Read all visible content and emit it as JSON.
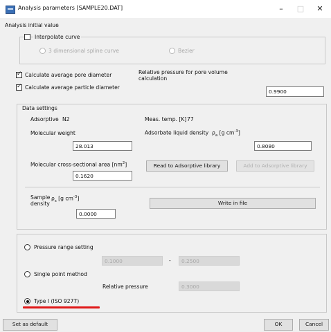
{
  "window": {
    "title": "Analysis parameters [SAMPLE20.DAT]",
    "min": "–",
    "max": "□",
    "close": "✕"
  },
  "analysis_initial_value": {
    "label": "Analysis initial value",
    "interpolate_label": "Interpolate curve",
    "spline_label": "3 dimensional spline curve",
    "bezier_label": "Bezier"
  },
  "calc": {
    "avg_pore_label": "Calculate average pore diameter",
    "avg_particle_label": "Calculate average particle diameter",
    "relp_label": "Relative pressure for pore volume calculation",
    "relp_value": "0.9900"
  },
  "data_settings": {
    "label": "Data settings",
    "adsorptive_label": "Adsorptive",
    "adsorptive_value": "N2",
    "meas_temp_label": "Meas. temp. [K]",
    "meas_temp_value": "77",
    "mw_label": "Molecular weight",
    "mw_value": "28.013",
    "ald_label": "Adsorbate liquid density",
    "ald_rho": "ρ",
    "ald_sub": "a",
    "ald_unit": "[g cm",
    "ald_sup": "-3",
    "ald_close": "]",
    "ald_value": "0.8080",
    "mcsa_label": "Molecular cross-sectional area [nm",
    "mcsa_sup": "2",
    "mcsa_close": "]",
    "mcsa_value": "0.1620",
    "read_button": "Read to Adsorptive library",
    "add_button": "Add to Adsorptive library",
    "sample_label": "Sample",
    "density_label": "density",
    "sd_rho": "ρ",
    "sd_sub": "s",
    "sd_unit": "[g cm",
    "sd_sup": "-3",
    "sd_close": "]",
    "sample_density_value": "0.0000",
    "write_button": "Write in file"
  },
  "method": {
    "pressure_range_label": "Pressure range setting",
    "pr_from": "0.1000",
    "pr_dash": "-",
    "pr_to": "0.2500",
    "single_point_label": "Single point method",
    "relp_label": "Relative pressure",
    "relp_value": "0.3000",
    "type1_label": "Type I (ISO 9277)"
  },
  "footer": {
    "default_button": "Set as default",
    "ok_button": "OK",
    "cancel_button": "Cancel"
  }
}
